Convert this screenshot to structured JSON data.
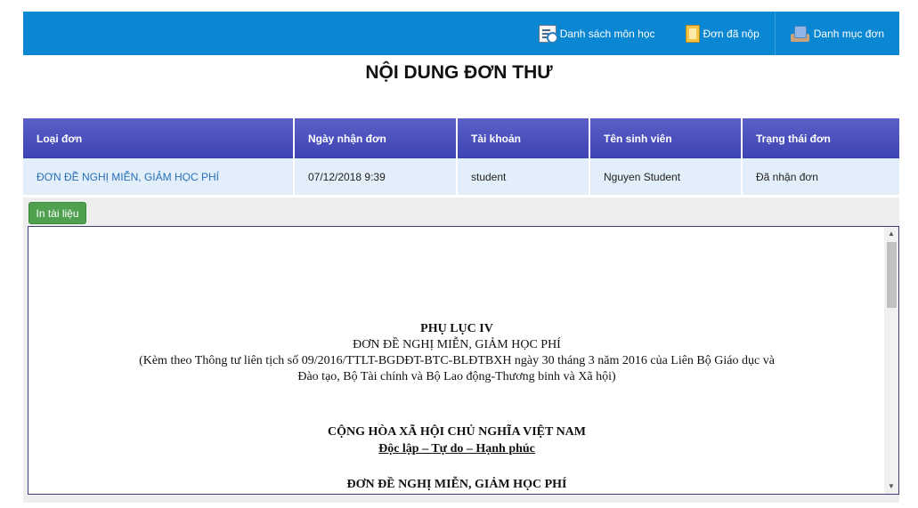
{
  "nav": {
    "items": [
      {
        "label": "Danh sách môn học",
        "icon": "course-list-icon"
      },
      {
        "label": "Đơn đã nộp",
        "icon": "document-icon"
      },
      {
        "label": "Danh mục đơn",
        "icon": "folder-icon"
      }
    ]
  },
  "page": {
    "title": "NỘI DUNG ĐƠN THƯ"
  },
  "table": {
    "headers": [
      "Loại đơn",
      "Ngày nhận đơn",
      "Tài khoản",
      "Tên sinh viên",
      "Trạng thái đơn"
    ],
    "rows": [
      [
        "ĐƠN ĐỀ NGHỊ MIỄN, GIẢM HỌC PHÍ",
        "07/12/2018 9:39",
        "student",
        "Nguyen Student",
        "Đã nhận đơn"
      ]
    ]
  },
  "actions": {
    "print_label": "In tài liệu"
  },
  "document": {
    "appendix": "PHỤ LỤC IV",
    "form_title": "ĐƠN ĐỀ NGHỊ MIỄN, GIẢM HỌC PHÍ",
    "note_line1": "(Kèm theo Thông tư liên tịch số 09/2016/TTLT-BGDĐT-BTC-BLĐTBXH ngày 30 tháng 3 năm 2016 của Liên Bộ Giáo dục và",
    "note_line2": "Đào tạo, Bộ Tài chính và Bộ Lao động-Thương binh và Xã hội)",
    "nation": "CỘNG HÒA XÃ HỘI CHỦ NGHĨA VIỆT NAM",
    "motto": "Độc lập – Tự do – Hạnh phúc",
    "heading": "ĐƠN ĐỀ NGHỊ MIỄN, GIẢM HỌC PHÍ"
  },
  "colors": {
    "topbar": "#0a87d2",
    "table_header": "#4549b9",
    "row_bg": "#e2eef9",
    "print_button": "#4fa04f"
  }
}
